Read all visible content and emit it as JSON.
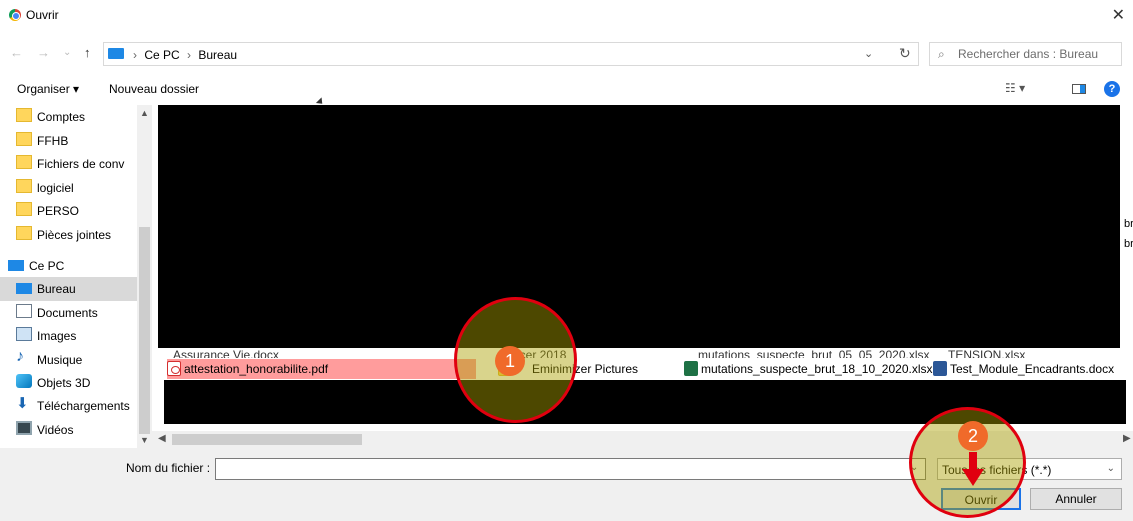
{
  "window": {
    "title": "Ouvrir",
    "close_label": "✕"
  },
  "address": {
    "back": "←",
    "forward": "→",
    "history": "⌄",
    "up": "↑",
    "crumbs": [
      "Ce PC",
      "Bureau"
    ],
    "dropdown": "⌄",
    "refresh": "↻"
  },
  "search": {
    "placeholder": "Rechercher dans : Bureau",
    "icon": "search-icon"
  },
  "toolbar": {
    "organiser": "Organiser ▾",
    "new_folder": "Nouveau dossier",
    "help": "?"
  },
  "sidebar": {
    "items": [
      {
        "label": "Comptes",
        "icon": "folder-icon"
      },
      {
        "label": "FFHB",
        "icon": "folder-icon"
      },
      {
        "label": "Fichiers de conv",
        "icon": "folder-icon"
      },
      {
        "label": "logiciel",
        "icon": "folder-icon"
      },
      {
        "label": "PERSO",
        "icon": "folder-icon"
      },
      {
        "label": "Pièces jointes",
        "icon": "folder-icon"
      },
      {
        "label": "Ce PC",
        "icon": "pc-icon"
      },
      {
        "label": "Bureau",
        "icon": "desktop-icon",
        "selected": true
      },
      {
        "label": "Documents",
        "icon": "documents-icon"
      },
      {
        "label": "Images",
        "icon": "images-icon"
      },
      {
        "label": "Musique",
        "icon": "music-icon"
      },
      {
        "label": "Objets 3D",
        "icon": "objects-3d-icon"
      },
      {
        "label": "Téléchargements",
        "icon": "downloads-icon"
      },
      {
        "label": "Vidéos",
        "icon": "videos-icon"
      }
    ]
  },
  "files": {
    "right_fragments": [
      "br",
      "br"
    ],
    "partial_row": [
      "Assurance Vie.docx",
      "ucer 2018",
      "mutations_suspecte_brut_05_05_2020.xlsx",
      "TENSION.xlsx"
    ],
    "visible_row": [
      {
        "label": "attestation_honorabilite.pdf",
        "icon": "pdf-icon",
        "selected": true
      },
      {
        "label": "Eminimizer Pictures",
        "icon": "folder-icon"
      },
      {
        "label": "mutations_suspecte_brut_18_10_2020.xlsx",
        "icon": "excel-icon"
      },
      {
        "label": "Test_Module_Encadrants.docx",
        "icon": "word-icon"
      }
    ]
  },
  "bottom": {
    "filename_label": "Nom du fichier :",
    "filename_value": "",
    "filter_value": "Tous les fichiers (*.*)",
    "open_label": "Ouvrir",
    "cancel_label": "Annuler"
  },
  "annotations": {
    "badge_1": "1",
    "badge_2": "2"
  },
  "colors": {
    "selection": "#ff9c9c",
    "annotation_red": "#e0000f",
    "badge": "#f06a2a",
    "accent": "#1a73e8"
  }
}
